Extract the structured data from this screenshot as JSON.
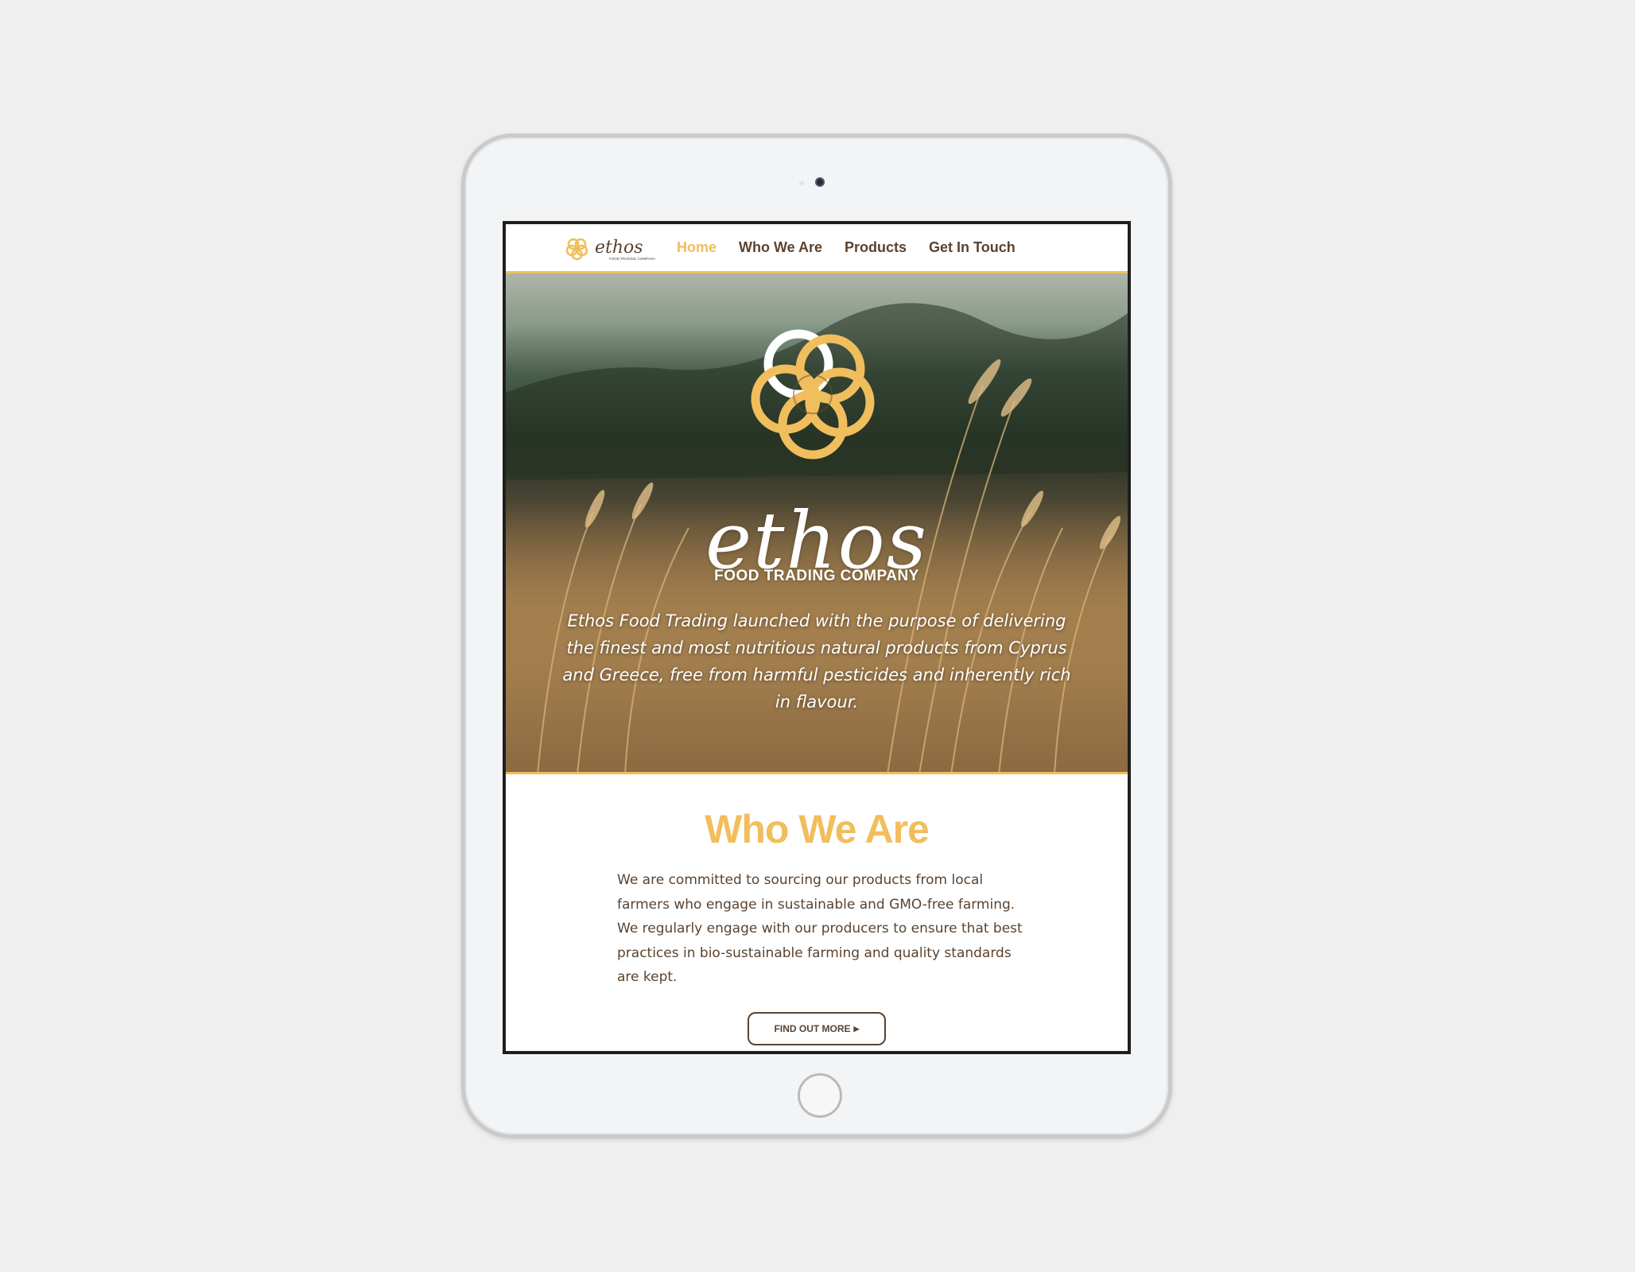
{
  "nav": {
    "logo_text": "ethos",
    "logo_subtext": "FOOD TRADING COMPANY",
    "items": [
      {
        "label": "Home",
        "active": true
      },
      {
        "label": "Who We Are",
        "active": false
      },
      {
        "label": "Products",
        "active": false
      },
      {
        "label": "Get In Touch",
        "active": false
      }
    ]
  },
  "hero": {
    "script_title": "ethos",
    "subtitle": "FOOD TRADING COMPANY",
    "text": "Ethos Food Trading launched with the purpose of delivering the finest and most nutritious natural products from Cyprus and Greece, free from harmful pesticides and inherently rich in flavour."
  },
  "about": {
    "title": "Who We Are",
    "text": "We are committed to sourcing our products from local farmers who engage in sustainable and GMO-free farming. We regularly engage with our producers to ensure that best practices in bio-sustainable farming and quality standards are kept.",
    "button_label": "FIND OUT MORE",
    "button_icon": "caret-right-icon"
  },
  "colors": {
    "accent": "#f1be5d",
    "text_brown": "#5a4330",
    "background": "#efefef"
  }
}
